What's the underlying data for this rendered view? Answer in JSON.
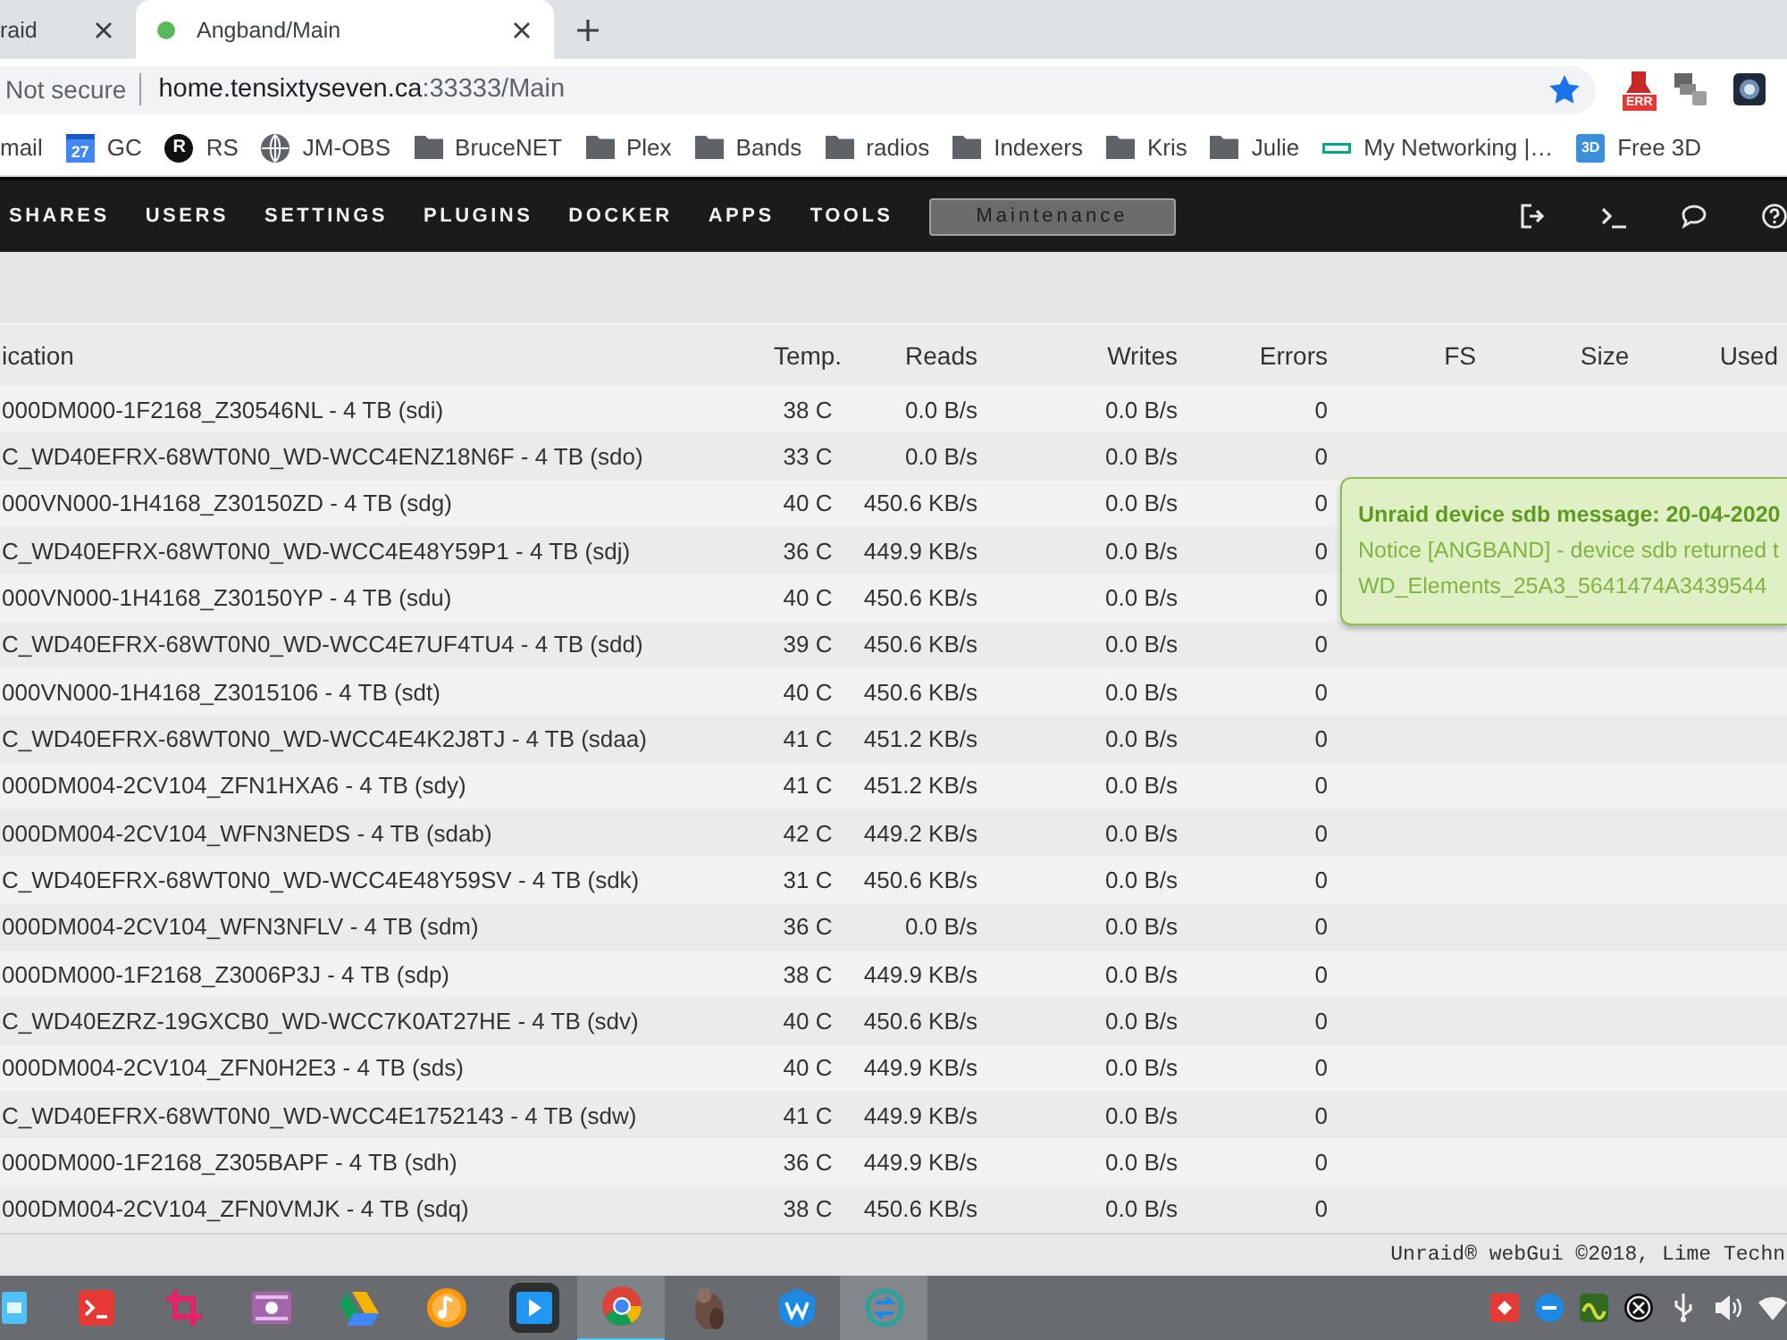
{
  "browser": {
    "tabs": [
      {
        "title": "raid",
        "selected": false
      },
      {
        "title": "Angband/Main",
        "selected": true
      }
    ],
    "address": {
      "security": "Not secure",
      "host": "home.tensixtyseven.ca",
      "path": ":33333/Main",
      "bookmarked": true
    },
    "extensions": [
      {
        "kind": "pin",
        "badge": "ERR"
      },
      {
        "kind": "tool"
      },
      {
        "kind": "orb"
      }
    ],
    "bookmarks": [
      {
        "label": "mail",
        "kind": "none"
      },
      {
        "label": "GC",
        "kind": "calendar",
        "icon_text": "27"
      },
      {
        "label": "RS",
        "kind": "letter",
        "icon_text": "R"
      },
      {
        "label": "JM-OBS",
        "kind": "globe"
      },
      {
        "label": "BruceNET",
        "kind": "folder"
      },
      {
        "label": "Plex",
        "kind": "folder"
      },
      {
        "label": "Bands",
        "kind": "folder"
      },
      {
        "label": "radios",
        "kind": "folder"
      },
      {
        "label": "Indexers",
        "kind": "folder"
      },
      {
        "label": "Kris",
        "kind": "folder"
      },
      {
        "label": "Julie",
        "kind": "folder"
      },
      {
        "label": "My Networking |…",
        "kind": "bar"
      },
      {
        "label": "Free 3D",
        "kind": "tile",
        "icon_text": "3D"
      }
    ]
  },
  "nav": {
    "items": [
      "SHARES",
      "USERS",
      "SETTINGS",
      "PLUGINS",
      "DOCKER",
      "APPS",
      "TOOLS"
    ],
    "status_button": "Maintenance"
  },
  "table": {
    "columns": [
      "ication",
      "Temp.",
      "Reads",
      "Writes",
      "Errors",
      "FS",
      "Size",
      "Used"
    ],
    "rows": [
      {
        "device": "000DM000-1F2168_Z30546NL - 4 TB (sdi)",
        "temp": "38 C",
        "reads": "0.0 B/s",
        "writes": "0.0 B/s",
        "errors": "0"
      },
      {
        "device": "C_WD40EFRX-68WT0N0_WD-WCC4ENZ18N6F - 4 TB (sdo)",
        "temp": "33 C",
        "reads": "0.0 B/s",
        "writes": "0.0 B/s",
        "errors": "0"
      },
      {
        "device": "000VN000-1H4168_Z30150ZD - 4 TB (sdg)",
        "temp": "40 C",
        "reads": "450.6 KB/s",
        "writes": "0.0 B/s",
        "errors": "0"
      },
      {
        "device": "C_WD40EFRX-68WT0N0_WD-WCC4E48Y59P1 - 4 TB (sdj)",
        "temp": "36 C",
        "reads": "449.9 KB/s",
        "writes": "0.0 B/s",
        "errors": "0"
      },
      {
        "device": "000VN000-1H4168_Z30150YP - 4 TB (sdu)",
        "temp": "40 C",
        "reads": "450.6 KB/s",
        "writes": "0.0 B/s",
        "errors": "0"
      },
      {
        "device": "C_WD40EFRX-68WT0N0_WD-WCC4E7UF4TU4 - 4 TB (sdd)",
        "temp": "39 C",
        "reads": "450.6 KB/s",
        "writes": "0.0 B/s",
        "errors": "0"
      },
      {
        "device": "000VN000-1H4168_Z3015106 - 4 TB (sdt)",
        "temp": "40 C",
        "reads": "450.6 KB/s",
        "writes": "0.0 B/s",
        "errors": "0"
      },
      {
        "device": "C_WD40EFRX-68WT0N0_WD-WCC4E4K2J8TJ - 4 TB (sdaa)",
        "temp": "41 C",
        "reads": "451.2 KB/s",
        "writes": "0.0 B/s",
        "errors": "0"
      },
      {
        "device": "000DM004-2CV104_ZFN1HXA6 - 4 TB (sdy)",
        "temp": "41 C",
        "reads": "451.2 KB/s",
        "writes": "0.0 B/s",
        "errors": "0"
      },
      {
        "device": "000DM004-2CV104_WFN3NEDS - 4 TB (sdab)",
        "temp": "42 C",
        "reads": "449.2 KB/s",
        "writes": "0.0 B/s",
        "errors": "0"
      },
      {
        "device": "C_WD40EFRX-68WT0N0_WD-WCC4E48Y59SV - 4 TB (sdk)",
        "temp": "31 C",
        "reads": "450.6 KB/s",
        "writes": "0.0 B/s",
        "errors": "0"
      },
      {
        "device": "000DM004-2CV104_WFN3NFLV - 4 TB (sdm)",
        "temp": "36 C",
        "reads": "0.0 B/s",
        "writes": "0.0 B/s",
        "errors": "0"
      },
      {
        "device": "000DM000-1F2168_Z3006P3J - 4 TB (sdp)",
        "temp": "38 C",
        "reads": "449.9 KB/s",
        "writes": "0.0 B/s",
        "errors": "0"
      },
      {
        "device": "C_WD40EZRZ-19GXCB0_WD-WCC7K0AT27HE - 4 TB (sdv)",
        "temp": "40 C",
        "reads": "450.6 KB/s",
        "writes": "0.0 B/s",
        "errors": "0"
      },
      {
        "device": "000DM004-2CV104_ZFN0H2E3 - 4 TB (sds)",
        "temp": "40 C",
        "reads": "449.9 KB/s",
        "writes": "0.0 B/s",
        "errors": "0"
      },
      {
        "device": "C_WD40EFRX-68WT0N0_WD-WCC4E1752143 - 4 TB (sdw)",
        "temp": "41 C",
        "reads": "449.9 KB/s",
        "writes": "0.0 B/s",
        "errors": "0"
      },
      {
        "device": "000DM000-1F2168_Z305BAPF - 4 TB (sdh)",
        "temp": "36 C",
        "reads": "449.9 KB/s",
        "writes": "0.0 B/s",
        "errors": "0"
      },
      {
        "device": "000DM004-2CV104_ZFN0VMJK - 4 TB (sdq)",
        "temp": "38 C",
        "reads": "450.6 KB/s",
        "writes": "0.0 B/s",
        "errors": "0"
      }
    ]
  },
  "notification": {
    "title": "Unraid device sdb message: 20-04-2020",
    "lines": [
      "Notice [ANGBAND] - device sdb returned t",
      "WD_Elements_25A3_5641474A3439544"
    ]
  },
  "footer": "Unraid® webGui ©2018, Lime Techn",
  "taskbar": {
    "apps": [
      {
        "active": false,
        "hovered": false
      },
      {
        "active": false,
        "hovered": false
      },
      {
        "active": false,
        "hovered": false
      },
      {
        "active": false,
        "hovered": false
      },
      {
        "active": false,
        "hovered": false
      },
      {
        "active": false,
        "hovered": false
      },
      {
        "active": false,
        "hovered": false
      },
      {
        "active": true,
        "hovered": false
      },
      {
        "active": false,
        "hovered": false
      },
      {
        "active": false,
        "hovered": false
      },
      {
        "active": false,
        "hovered": true
      }
    ]
  }
}
